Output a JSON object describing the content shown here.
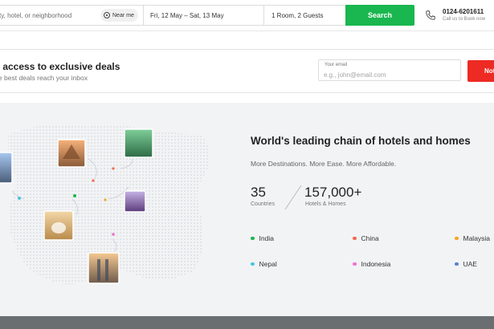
{
  "search": {
    "city_placeholder": "Search by city, hotel, or neighborhood",
    "near_me": "Near me",
    "dates": "Fri, 12 May – Sat, 13 May",
    "guests": "1 Room, 2 Guests",
    "search_label": "Search",
    "phone_number": "0124-6201611",
    "phone_sub": "Call us to Book now"
  },
  "deals": {
    "title": "Get access to exclusive deals",
    "subtitle": "Only the best deals reach your inbox",
    "email_label": "Your email",
    "email_placeholder": "e.g., john@email.com",
    "notify_label": "Notify"
  },
  "hero": {
    "title": "World's leading chain of hotels and homes",
    "subtitle": "More Destinations. More Ease. More Affordable.",
    "stats": [
      {
        "value": "35",
        "label": "Countries"
      },
      {
        "value": "157,000+",
        "label": "Hotels & Homes"
      }
    ],
    "countries": [
      {
        "name": "India",
        "color": "#1ab64f"
      },
      {
        "name": "China",
        "color": "#f06a4b"
      },
      {
        "name": "Malaysia",
        "color": "#f5a623"
      },
      {
        "name": "Nepal",
        "color": "#4fc3e8"
      },
      {
        "name": "Indonesia",
        "color": "#f06fd2"
      },
      {
        "name": "UAE",
        "color": "#5b7fd6"
      }
    ]
  },
  "colors": {
    "accent_green": "#1ab64f",
    "accent_red": "#ee2a24",
    "hero_bg": "#f2f3f5"
  }
}
